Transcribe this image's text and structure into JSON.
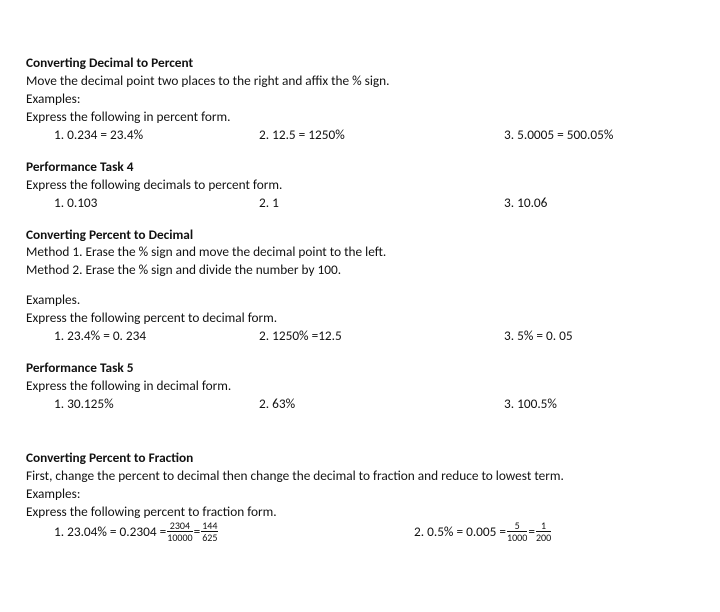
{
  "s1": {
    "title": "Converting Decimal to Percent",
    "rule": "Move the decimal point two places to the right and affix the % sign.",
    "exLabel": "Examples:",
    "prompt": "Express the following in percent form.",
    "items": {
      "i1": "1.   0.234 = 23.4%",
      "i2": "2.  12.5 = 1250%",
      "i3": "3. 5.0005 = 500.05%"
    }
  },
  "pt4": {
    "title": "Performance Task 4",
    "prompt": "Express the following decimals to percent form.",
    "items": {
      "i1": "1.   0.103",
      "i2": "2.  1",
      "i3": "3. 10.06"
    }
  },
  "s2": {
    "title": "Converting Percent to Decimal",
    "m1": "Method 1. Erase the % sign and move the decimal point to the left.",
    "m2": "Method 2. Erase the % sign and divide the number by 100.",
    "exLabel": "Examples.",
    "prompt": "Express the following percent to decimal form.",
    "items": {
      "i1": "1.   23.4% = 0. 234",
      "i2": "2. 1250% =12.5",
      "i3": "3.  5% = 0. 05"
    }
  },
  "pt5": {
    "title": "Performance Task 5",
    "prompt": "Express the following in decimal form.",
    "items": {
      "i1": "1.   30.125%",
      "i2": "2. 63%",
      "i3": "3.  100.5%"
    }
  },
  "s3": {
    "title": "Converting Percent to Fraction",
    "rule": "First, change the percent to decimal then change the decimal to fraction and reduce to lowest term.",
    "exLabel": "Examples:",
    "prompt": "Express the following percent to fraction form.",
    "ex1": {
      "lead": "1.   23.04% = 0.2304 = ",
      "f1n": "2304",
      "f1d": "10000",
      "eq": "=",
      "f2n": "144",
      "f2d": "625"
    },
    "ex2": {
      "lead": "2. 0.5% = 0.005 = ",
      "f1n": "5",
      "f1d": "1000",
      "eq": "=",
      "f2n": "1",
      "f2d": "200"
    }
  }
}
